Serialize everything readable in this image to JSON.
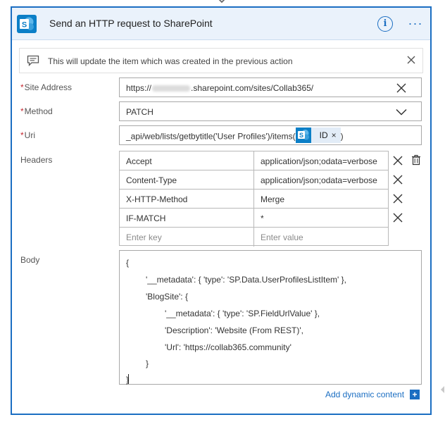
{
  "card": {
    "title": "Send an HTTP request to SharePoint",
    "info_icon": "info-icon",
    "more_icon": "more-options-icon",
    "notice": "This will update the item which was created in the previous action"
  },
  "fields": {
    "site_address": {
      "required_mark": "*",
      "label": "Site Address",
      "value_prefix": "https://",
      "value_blurred": true,
      "value_suffix": ".sharepoint.com/sites/Collab365/"
    },
    "method": {
      "required_mark": "*",
      "label": "Method",
      "value": "PATCH"
    },
    "uri": {
      "required_mark": "*",
      "label": "Uri",
      "value_prefix": "_api/web/lists/getbytitle('User Profiles')/items(",
      "token_label": "ID",
      "token_remove": "×",
      "value_suffix": ")"
    }
  },
  "headers": {
    "label": "Headers",
    "rows": [
      {
        "key": "Accept",
        "value": "application/json;odata=verbose"
      },
      {
        "key": "Content-Type",
        "value": "application/json;odata=verbose"
      },
      {
        "key": "X-HTTP-Method",
        "value": "Merge"
      },
      {
        "key": "IF-MATCH",
        "value": "*"
      }
    ],
    "key_placeholder": "Enter key",
    "value_placeholder": "Enter value"
  },
  "body": {
    "label": "Body",
    "lines": [
      {
        "indent": 0,
        "text": "{"
      },
      {
        "indent": 1,
        "text": "'__metadata': { 'type': 'SP.Data.UserProfilesListItem' },"
      },
      {
        "indent": 1,
        "text": "'BlogSite': {"
      },
      {
        "indent": 2,
        "text": "'__metadata': { 'type': 'SP.FieldUrlValue' },"
      },
      {
        "indent": 2,
        "text": "'Description': 'Website (From REST)',"
      },
      {
        "indent": 2,
        "text": "'Url': 'https://collab365.community'"
      },
      {
        "indent": 1,
        "text": "}"
      },
      {
        "indent": 0,
        "text": "}"
      }
    ]
  },
  "dynamic_content": {
    "label": "Add dynamic content",
    "plus": "+"
  },
  "colors": {
    "accent": "#1b6ec2",
    "header_bg": "#eaf2fb",
    "sharepoint": "#0b7fc7",
    "required": "#c4262e",
    "token_bg": "#e2ecf7"
  }
}
